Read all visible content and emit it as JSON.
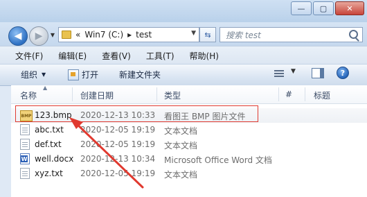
{
  "window": {
    "minimize_glyph": "—",
    "maximize_glyph": "▢",
    "close_glyph": "✕"
  },
  "nav": {
    "back_glyph": "◀",
    "forward_glyph": "▶",
    "address_prefix": "«",
    "address_drive": "Win7 (C:)",
    "address_sep": "▸",
    "address_folder": "test",
    "search_placeholder": "搜索 test"
  },
  "menubar": {
    "items": [
      "文件(F)",
      "编辑(E)",
      "查看(V)",
      "工具(T)",
      "帮助(H)"
    ]
  },
  "toolbar": {
    "organize_label": "组织",
    "open_label": "打开",
    "new_folder_label": "新建文件夹",
    "help_glyph": "?"
  },
  "columns": {
    "name": "名称",
    "date": "创建日期",
    "type": "类型",
    "number": "#",
    "title": "标题"
  },
  "files": [
    {
      "name": "123.bmp",
      "date": "2020-12-13 10:33",
      "type": "看图王 BMP 图片文件",
      "icon": "bmp-file-icon",
      "selected": true
    },
    {
      "name": "abc.txt",
      "date": "2020-12-05 19:19",
      "type": "文本文档",
      "icon": "text-file-icon"
    },
    {
      "name": "def.txt",
      "date": "2020-12-05 19:19",
      "type": "文本文档",
      "icon": "text-file-icon"
    },
    {
      "name": "well.docx",
      "date": "2020-12-13 10:34",
      "type": "Microsoft Office Word 文档",
      "icon": "word-file-icon"
    },
    {
      "name": "xyz.txt",
      "date": "2020-12-05 19:19",
      "type": "文本文档",
      "icon": "text-file-icon"
    }
  ],
  "colors": {
    "highlight_box": "#e0392f",
    "annotation_arrow": "#e0392f"
  }
}
